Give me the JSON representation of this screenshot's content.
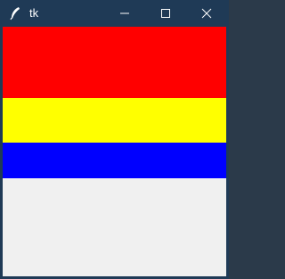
{
  "window": {
    "title": "tk",
    "app_icon": "feather-icon",
    "controls": {
      "minimize": "minimize-icon",
      "maximize": "maximize-icon",
      "close": "close-icon"
    }
  },
  "client": {
    "background": "#f0f0f0",
    "bands": [
      {
        "name": "red-band",
        "color": "#ff0000"
      },
      {
        "name": "yellow-band",
        "color": "#ffff00"
      },
      {
        "name": "blue-band",
        "color": "#0000ff"
      }
    ]
  },
  "colors": {
    "titlebar": "#1f3a56",
    "title_text": "#ffffff"
  }
}
